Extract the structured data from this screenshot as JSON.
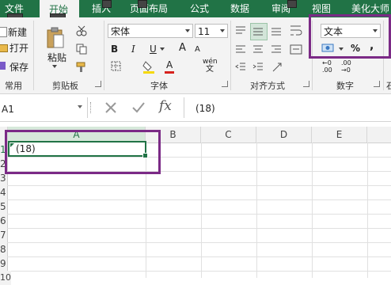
{
  "tabs": {
    "file": "文件",
    "home": "开始",
    "insert": "插入",
    "page_layout": "页面布局",
    "formulas": "公式",
    "data": "数据",
    "review": "审阅",
    "view": "视图",
    "beautify": "美化大师"
  },
  "keytips": {
    "file": "F",
    "home": "H"
  },
  "clipboard": {
    "new": "新建",
    "open": "打开",
    "save": "保存",
    "paste": "粘贴",
    "common_label": "常用",
    "clipboard_label": "剪贴板"
  },
  "font": {
    "name": "宋体",
    "size": "11",
    "bold": "B",
    "italic": "I",
    "underline": "U",
    "grow": "A",
    "shrink": "A",
    "font_color_glyph": "A",
    "phonetic": "wén",
    "phonetic_char": "文",
    "label": "字体"
  },
  "alignment": {
    "label": "对齐方式"
  },
  "number": {
    "format": "文本",
    "percent": "%",
    "comma": ",",
    "inc_decimal_a": "←0",
    "inc_decimal_b": ".00",
    "dec_decimal_a": ".00",
    "dec_decimal_b": "→0",
    "label": "数字",
    "overflow": "石"
  },
  "formula_bar": {
    "name_box": "A1",
    "fx": "fx",
    "value": "(18)"
  },
  "grid": {
    "columns": [
      "A",
      "B",
      "C",
      "D",
      "E"
    ],
    "rows": [
      "1",
      "2",
      "3",
      "4",
      "5",
      "6",
      "7",
      "8",
      "9",
      "10"
    ],
    "cell_a1": "(18)"
  },
  "colors": {
    "ribbon_green": "#217346",
    "highlight_purple": "#7b2a86",
    "font_color_red": "#d6221d",
    "fill_yellow": "#f5d90a"
  }
}
